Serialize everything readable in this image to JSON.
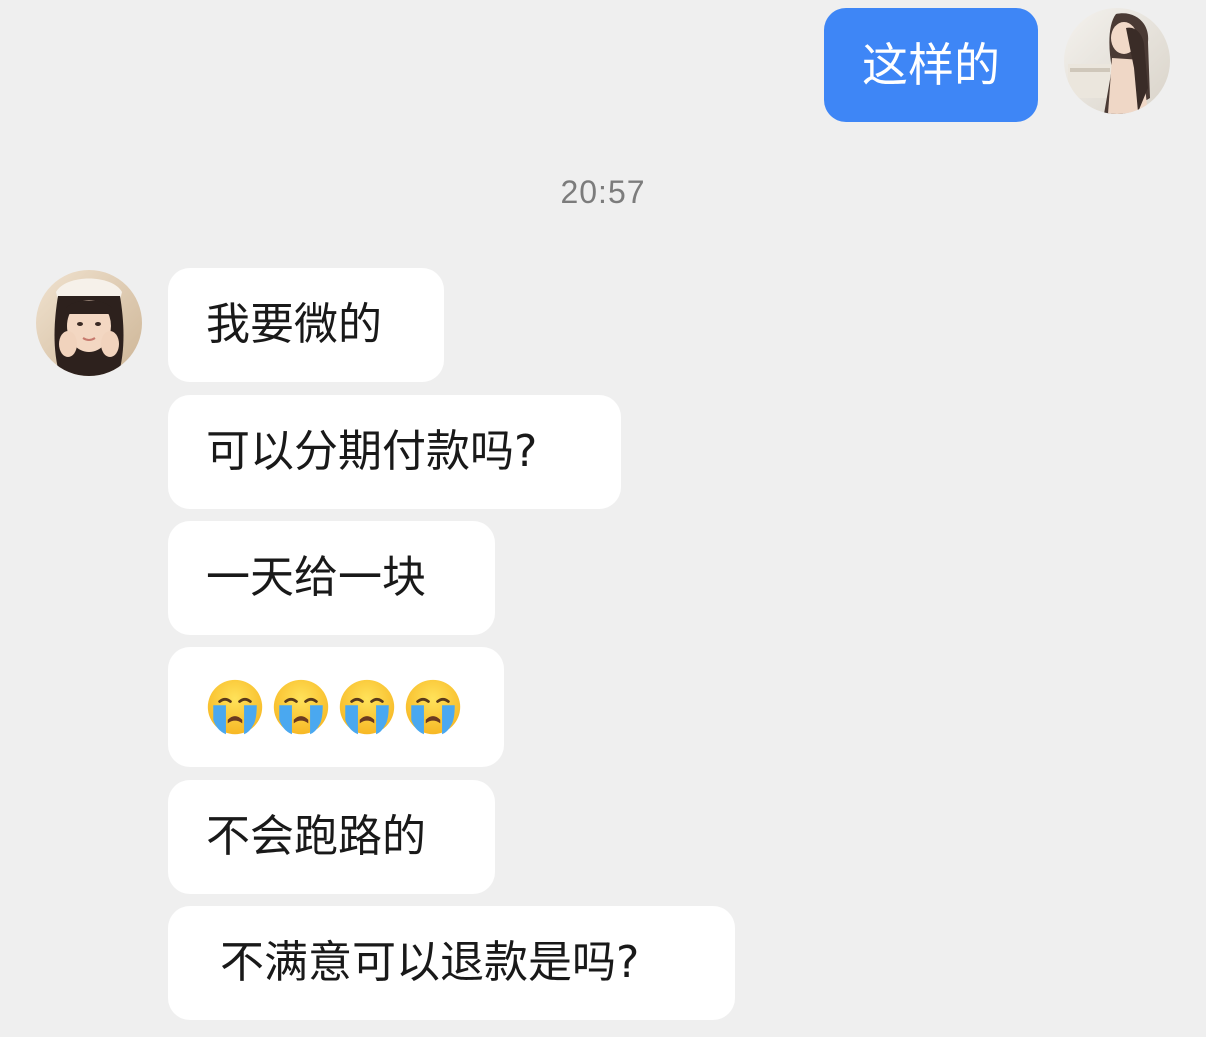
{
  "sent_messages": [
    {
      "text": "这样的"
    }
  ],
  "timestamp": "20:57",
  "received_messages": [
    {
      "text": "我要微的"
    },
    {
      "text": "可以分期付款吗?"
    },
    {
      "text": "一天给一块"
    },
    {
      "emojis": [
        "loudly-crying-face",
        "loudly-crying-face",
        "loudly-crying-face",
        "loudly-crying-face"
      ]
    },
    {
      "text": "不会跑路的"
    },
    {
      "text": " 不满意可以退款是吗?"
    }
  ],
  "colors": {
    "background": "#efefef",
    "sent_bubble": "#3e86f6",
    "received_bubble": "#ffffff",
    "timestamp": "#7c7c7c"
  },
  "icons": {
    "sender_avatar": "user-avatar-photo",
    "contact_avatar": "contact-avatar-photo"
  }
}
